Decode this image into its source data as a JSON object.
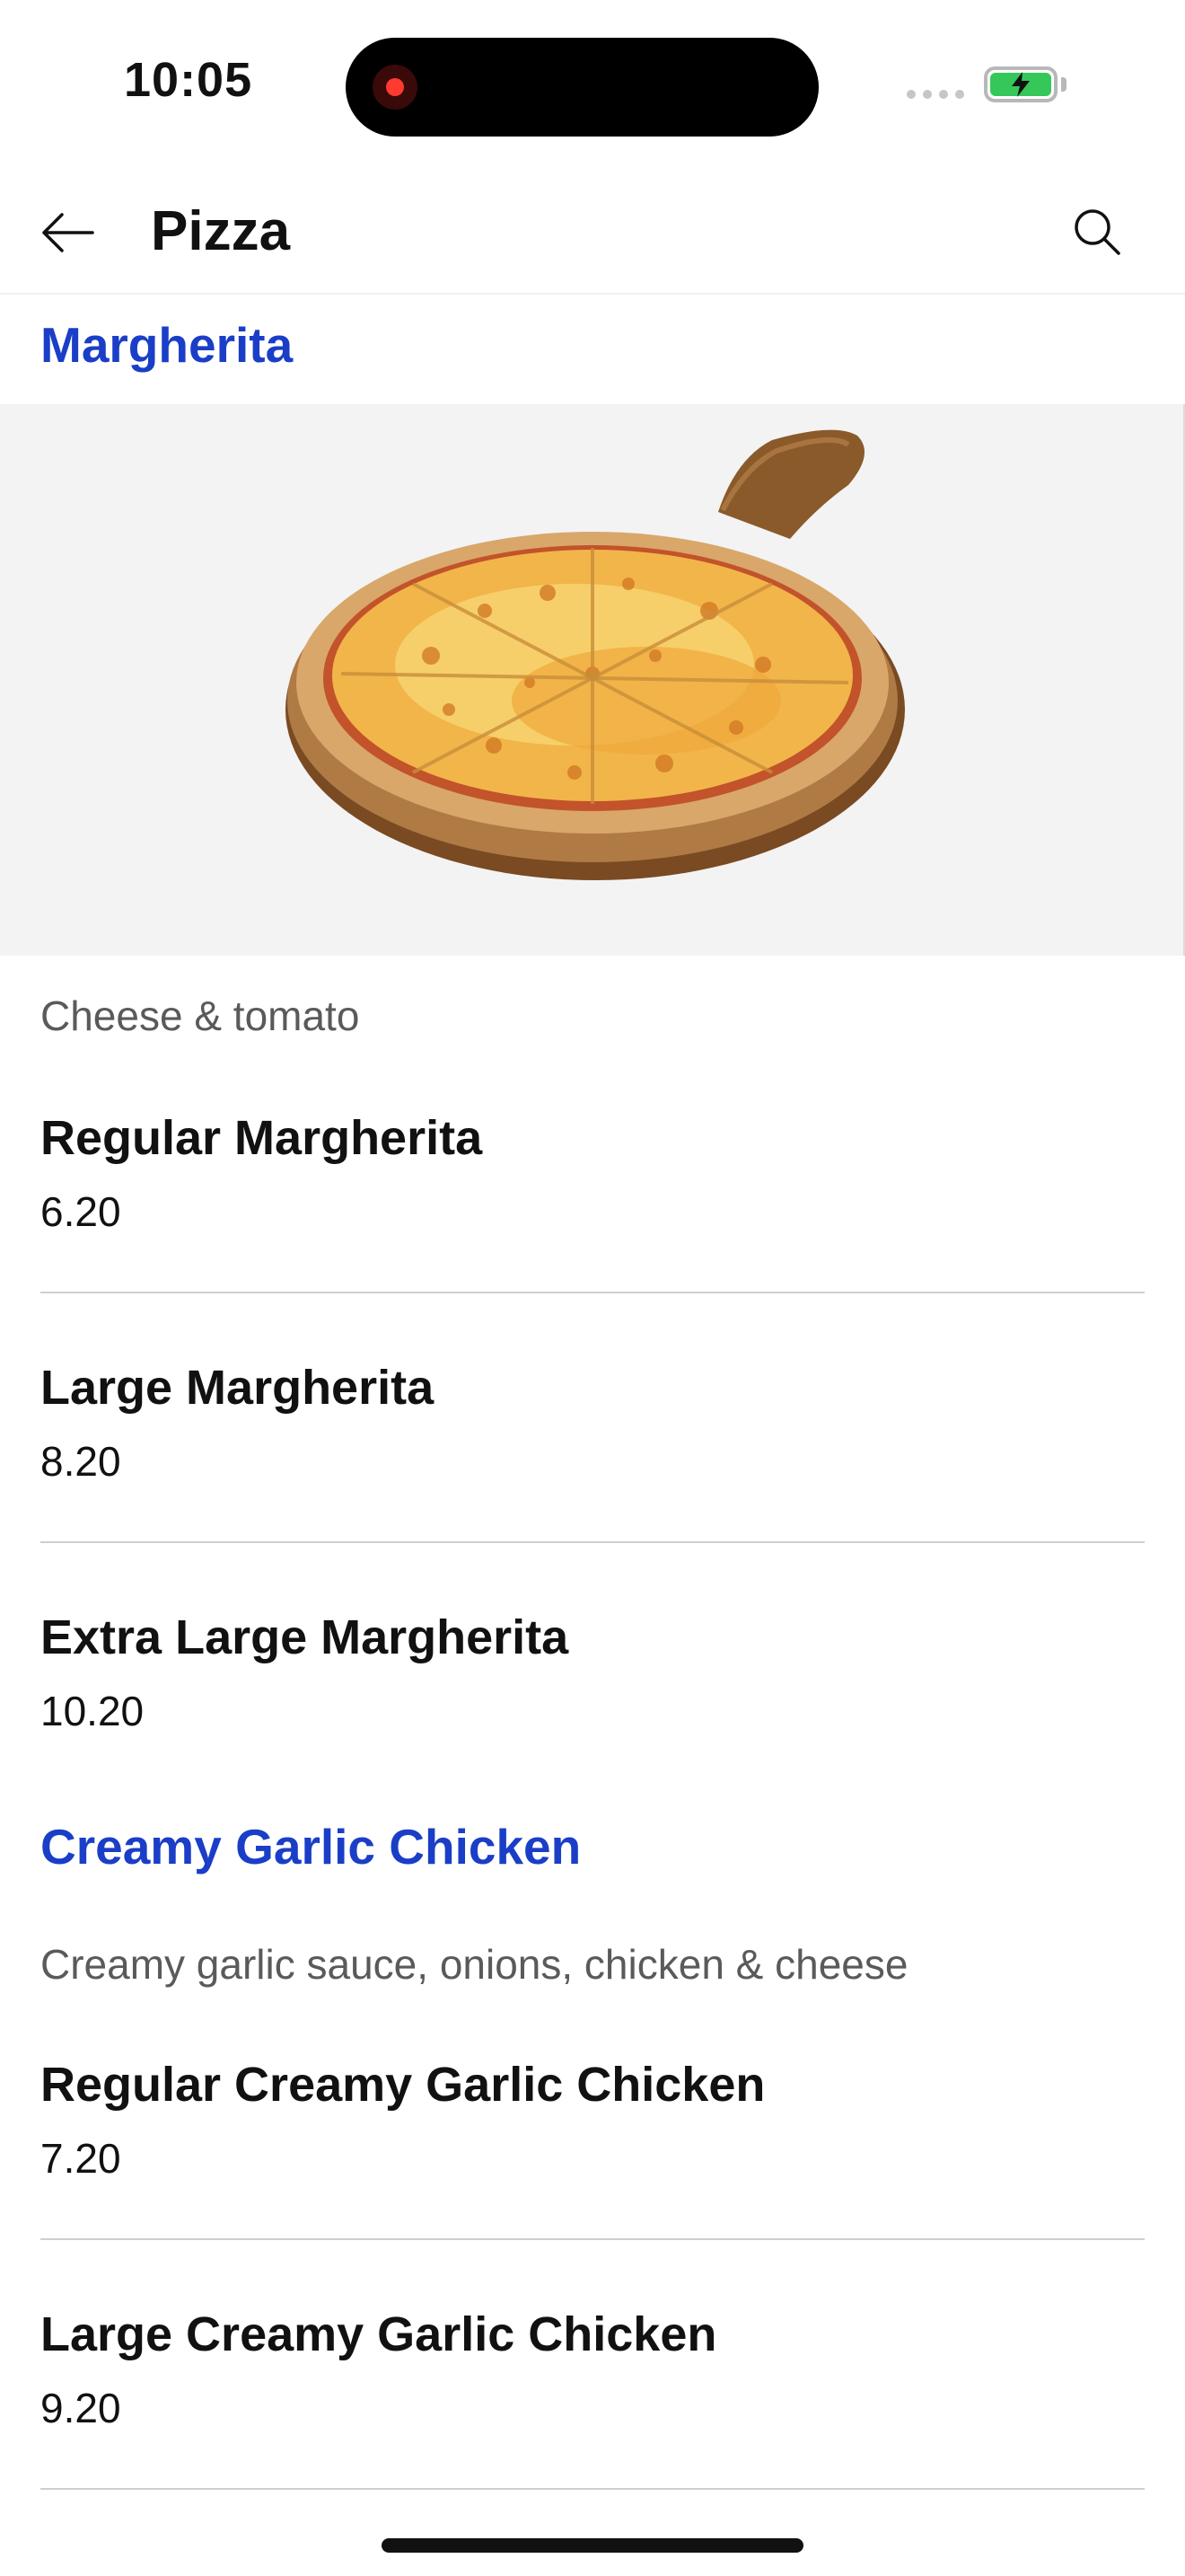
{
  "status_bar": {
    "time": "10:05"
  },
  "header": {
    "title": "Pizza"
  },
  "sections": [
    {
      "title": "Margherita",
      "description": "Cheese & tomato",
      "items": [
        {
          "name": "Regular Margherita",
          "price": "6.20"
        },
        {
          "name": "Large Margherita",
          "price": "8.20"
        },
        {
          "name": "Extra Large Margherita",
          "price": "10.20"
        }
      ]
    },
    {
      "title": "Creamy Garlic Chicken",
      "description": "Creamy garlic sauce, onions, chicken & cheese",
      "items": [
        {
          "name": "Regular Creamy Garlic Chicken",
          "price": "7.20"
        },
        {
          "name": "Large Creamy Garlic Chicken",
          "price": "9.20"
        }
      ]
    }
  ],
  "colors": {
    "section_title": "#1a3ec7",
    "description": "#5a5a5a",
    "battery": "#35c759",
    "recording": "#ff3b30"
  },
  "icons": {
    "back": "arrow-left-icon",
    "search": "search-icon",
    "battery": "battery-charging-icon",
    "recording": "recording-icon"
  }
}
